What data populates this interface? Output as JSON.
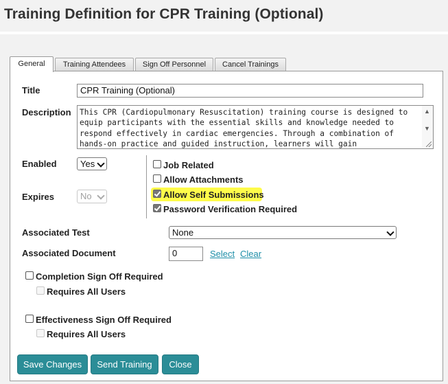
{
  "page": {
    "title": "Training Definition for CPR Training (Optional)"
  },
  "tabs": [
    {
      "label": "General",
      "active": true
    },
    {
      "label": "Training Attendees",
      "active": false
    },
    {
      "label": "Sign Off Personnel",
      "active": false
    },
    {
      "label": "Cancel Trainings",
      "active": false
    }
  ],
  "form": {
    "title_label": "Title",
    "title_value": "CPR Training (Optional)",
    "description_label": "Description",
    "description_value": "This CPR (Cardiopulmonary Resuscitation) training course is designed to equip participants with the essential skills and knowledge needed to respond effectively in cardiac emergencies. Through a combination of hands-on practice and guided instruction, learners will gain",
    "enabled_label": "Enabled",
    "enabled_value": "Yes",
    "expires_label": "Expires",
    "expires_value": "No",
    "checkboxes": {
      "job_related": {
        "label": "Job Related",
        "checked": false
      },
      "allow_attachments": {
        "label": "Allow Attachments",
        "checked": false
      },
      "allow_self_submissions": {
        "label": "Allow Self Submissions",
        "checked": true
      },
      "password_verification": {
        "label": "Password Verification Required",
        "checked": true
      }
    },
    "associated_test_label": "Associated Test",
    "associated_test_value": "None",
    "associated_document_label": "Associated Document",
    "associated_document_value": "0",
    "select_link": "Select",
    "clear_link": "Clear",
    "completion_signoff": {
      "label": "Completion Sign Off Required",
      "checked": false
    },
    "completion_requires_all": {
      "label": "Requires All Users",
      "checked": false
    },
    "effectiveness_signoff": {
      "label": "Effectiveness Sign Off Required",
      "checked": false
    },
    "effectiveness_requires_all": {
      "label": "Requires All Users",
      "checked": false
    }
  },
  "buttons": {
    "save": "Save Changes",
    "send": "Send Training",
    "close": "Close"
  },
  "colors": {
    "button_bg": "#2b8d97",
    "link": "#1f8fa8",
    "highlight": "#fefb4a"
  },
  "icons": {
    "dropdown": "chevron-down-icon",
    "scroll_up": "arrow-up-icon",
    "scroll_down": "arrow-down-icon",
    "checkmark": "checkmark-icon"
  }
}
